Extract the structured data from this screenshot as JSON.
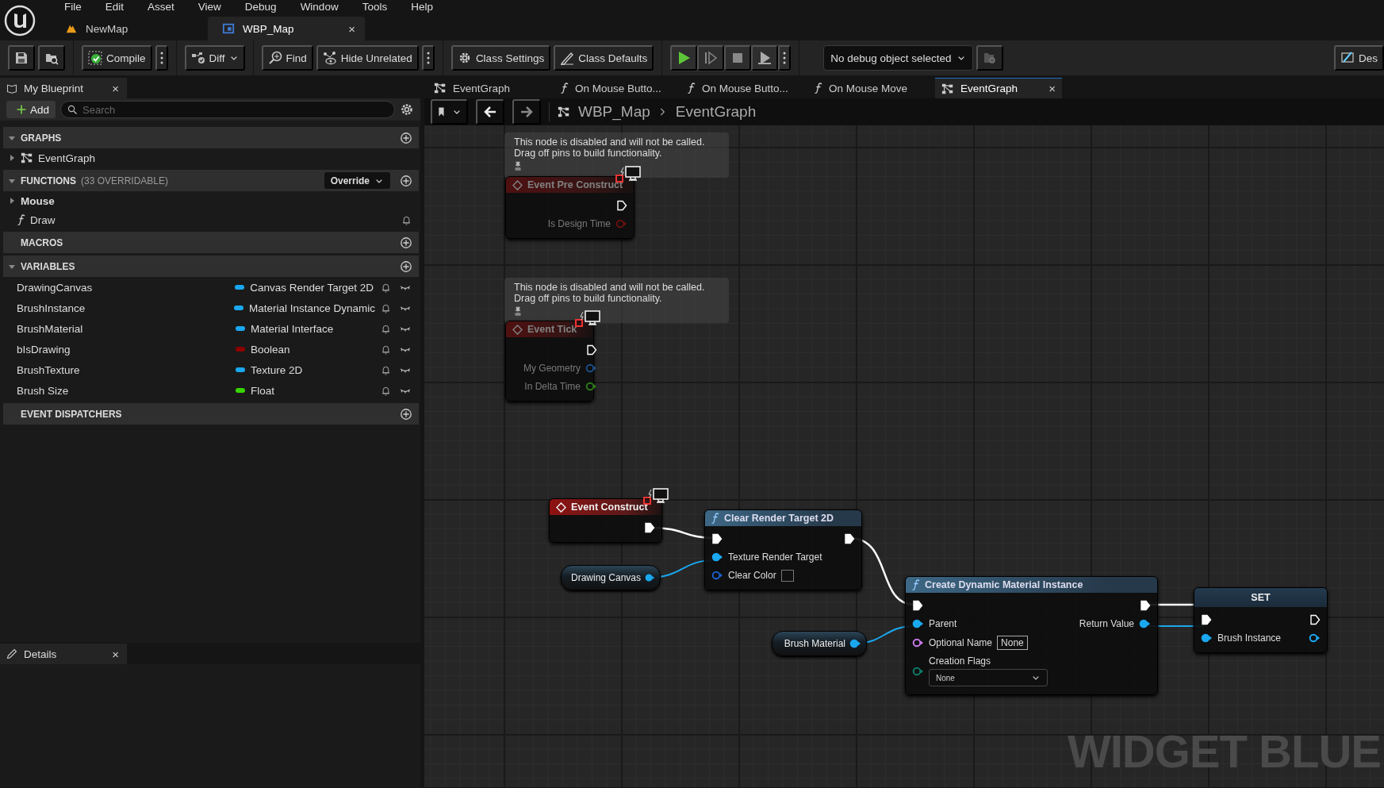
{
  "menu": [
    "File",
    "Edit",
    "Asset",
    "View",
    "Debug",
    "Window",
    "Tools",
    "Help"
  ],
  "doc_tabs": [
    {
      "kind": "level",
      "label": "NewMap",
      "selected": false
    },
    {
      "kind": "widget",
      "label": "WBP_Map",
      "selected": true,
      "close": "×"
    }
  ],
  "toolbar": [
    [
      {
        "kind": "save"
      },
      {
        "kind": "browse"
      }
    ],
    [
      {
        "kind": "compile",
        "label": "Compile"
      },
      {
        "kind": "more"
      }
    ],
    [
      {
        "kind": "diff",
        "label": "Diff"
      }
    ],
    [
      {
        "kind": "find",
        "label": "Find"
      },
      {
        "kind": "hide",
        "label": "Hide Unrelated"
      },
      {
        "kind": "more"
      }
    ],
    [
      {
        "kind": "settings",
        "label": "Class Settings"
      },
      {
        "kind": "defaults",
        "label": "Class Defaults"
      }
    ],
    [
      {
        "kind": "play"
      },
      {
        "kind": "advance"
      },
      {
        "kind": "stop"
      },
      {
        "kind": "eject"
      },
      {
        "kind": "more"
      }
    ],
    [
      {
        "kind": "debug",
        "label": "No debug object selected"
      },
      {
        "kind": "debug_browse"
      }
    ],
    [
      {
        "kind": "designer",
        "label": "Des"
      }
    ]
  ],
  "my_blueprint": {
    "tab": "My Blueprint",
    "close": "×",
    "add": "Add",
    "search": {
      "placeholder": "Search"
    },
    "sections": [
      {
        "title": "GRAPHS",
        "expanded": true,
        "items": [
          {
            "kind": "graph",
            "label": "EventGraph",
            "expanded": false
          }
        ]
      },
      {
        "title": "FUNCTIONS",
        "note": "(33 OVERRIDABLE)",
        "dropdown": "Override",
        "expanded": true,
        "items": [
          {
            "kind": "category",
            "label": "Mouse",
            "expanded": false
          },
          {
            "kind": "function",
            "label": "Draw"
          }
        ]
      },
      {
        "title": "MACROS"
      },
      {
        "title": "VARIABLES",
        "expanded": true,
        "items": [
          {
            "kind": "variable",
            "label": "DrawingCanvas",
            "type": "Canvas Render Target 2D",
            "color": "#1aa8f0"
          },
          {
            "kind": "variable",
            "label": "BrushInstance",
            "type": "Material Instance Dynamic",
            "color": "#1aa8f0"
          },
          {
            "kind": "variable",
            "label": "BrushMaterial",
            "type": "Material Interface",
            "color": "#1aa8f0"
          },
          {
            "kind": "variable",
            "label": "bIsDrawing",
            "type": "Boolean",
            "color": "#8c0000"
          },
          {
            "kind": "variable",
            "label": "BrushTexture",
            "type": "Texture 2D",
            "color": "#1aa8f0"
          },
          {
            "kind": "variable",
            "label": "Brush Size",
            "type": "Float",
            "color": "#38d500"
          }
        ]
      },
      {
        "title": "EVENT DISPATCHERS"
      }
    ]
  },
  "details": {
    "tab": "Details",
    "close": "×"
  },
  "graph_tabs": [
    {
      "kind": "graph",
      "label": "EventGraph",
      "selected": false
    },
    {
      "kind": "function",
      "label": "On Mouse Butto...",
      "selected": false
    },
    {
      "kind": "function",
      "label": "On Mouse Butto...",
      "selected": false
    },
    {
      "kind": "function",
      "label": "On Mouse Move",
      "selected": false
    },
    {
      "kind": "graph",
      "label": "EventGraph",
      "selected": true,
      "close": "×"
    }
  ],
  "breadcrumb": [
    "WBP_Map",
    "EventGraph"
  ],
  "nodes": [
    {
      "kind": "comment",
      "text": "This node is disabled and will not be called.\nDrag off pins to build functionality."
    },
    {
      "kind": "event",
      "title": "Event Pre Construct",
      "disabled": true,
      "outputs": [
        {
          "kind": "exec",
          "connected": false
        },
        {
          "kind": "data",
          "label": "Is Design Time",
          "color": "#6a1010",
          "connected": false
        }
      ]
    },
    {
      "kind": "comment",
      "text": "This node is disabled and will not be called.\nDrag off pins to build functionality."
    },
    {
      "kind": "event",
      "title": "Event Tick",
      "disabled": true,
      "outputs": [
        {
          "kind": "exec",
          "connected": false
        },
        {
          "kind": "data",
          "label": "My Geometry",
          "color": "#1d4e86",
          "connected": false
        },
        {
          "kind": "data",
          "label": "In Delta Time",
          "color": "#2d7a1a",
          "connected": false
        }
      ]
    },
    {
      "kind": "event",
      "title": "Event Construct",
      "disabled": false,
      "outputs": [
        {
          "kind": "exec",
          "connected": true
        }
      ]
    },
    {
      "kind": "function",
      "title": "Clear Render Target 2D",
      "inputs": [
        {
          "kind": "exec",
          "connected": true
        },
        {
          "kind": "data",
          "label": "Texture Render Target",
          "color": "#1aa8f0",
          "connected": true
        },
        {
          "kind": "color_data",
          "label": "Clear Color",
          "color": "#1a5fc8",
          "connected": false
        }
      ],
      "outputs": [
        {
          "kind": "exec",
          "connected": true
        }
      ]
    },
    {
      "kind": "variable",
      "label": "Drawing Canvas",
      "pin": {
        "color": "#1aa8f0",
        "connected": true
      }
    },
    {
      "kind": "variable",
      "label": "Brush Material",
      "pin": {
        "color": "#1aa8f0",
        "connected": true
      }
    },
    {
      "kind": "function",
      "title": "Create Dynamic Material Instance",
      "inputs": [
        {
          "kind": "exec",
          "connected": true
        },
        {
          "kind": "data",
          "label": "Parent",
          "color": "#1aa8f0",
          "connected": true
        },
        {
          "kind": "data",
          "label": "Optional Name",
          "color": "#c87ae8",
          "connected": false,
          "value": "None"
        },
        {
          "kind": "data",
          "label": "Creation Flags",
          "color": "#0d7a6a",
          "connected": false,
          "dropdown": "None"
        }
      ],
      "outputs": [
        {
          "kind": "exec",
          "connected": true
        },
        {
          "kind": "data",
          "label": "Return Value",
          "color": "#1aa8f0",
          "connected": true
        }
      ]
    },
    {
      "kind": "set",
      "title": "SET",
      "inputs": [
        {
          "kind": "exec",
          "connected": true
        },
        {
          "kind": "data",
          "label": "Brush Instance",
          "color": "#1aa8f0",
          "connected": true
        }
      ],
      "outputs": [
        {
          "kind": "exec",
          "connected": false
        },
        {
          "kind": "data",
          "color": "#1aa8f0",
          "connected": false
        }
      ]
    }
  ],
  "graph_label": "WIDGET BLUE"
}
